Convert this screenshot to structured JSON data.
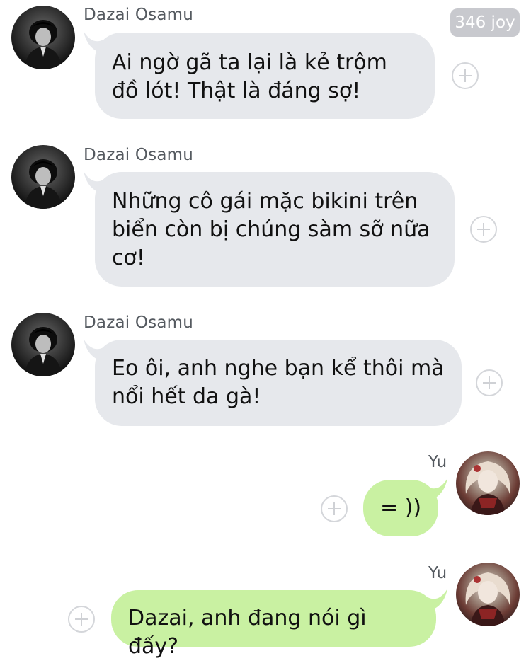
{
  "header": {
    "badge_text": "346 joy"
  },
  "messages": [
    {
      "sender": "Dazai Osamu",
      "text": "Ai ngờ gã ta lại là kẻ trộm đồ lót! Thật là đáng sợ!",
      "direction": "incoming"
    },
    {
      "sender": "Dazai Osamu",
      "text": "Những cô gái mặc bikini trên biển còn bị chúng sàm sỡ nữa cơ!",
      "direction": "incoming"
    },
    {
      "sender": "Dazai Osamu",
      "text": "Eo ôi, anh nghe bạn kể thôi mà nổi hết da gà!",
      "direction": "incoming"
    },
    {
      "sender": "Yu",
      "text": "= ))",
      "direction": "outgoing"
    },
    {
      "sender": "Yu",
      "text": "Dazai, anh đang nói gì đấy?",
      "direction": "outgoing"
    }
  ],
  "colors": {
    "incoming_bubble": "#e6e8ec",
    "outgoing_bubble": "#c9f1a2",
    "badge_bg": "#c8c9ce"
  },
  "icons": {
    "reaction_button": "plus-circle-icon"
  }
}
